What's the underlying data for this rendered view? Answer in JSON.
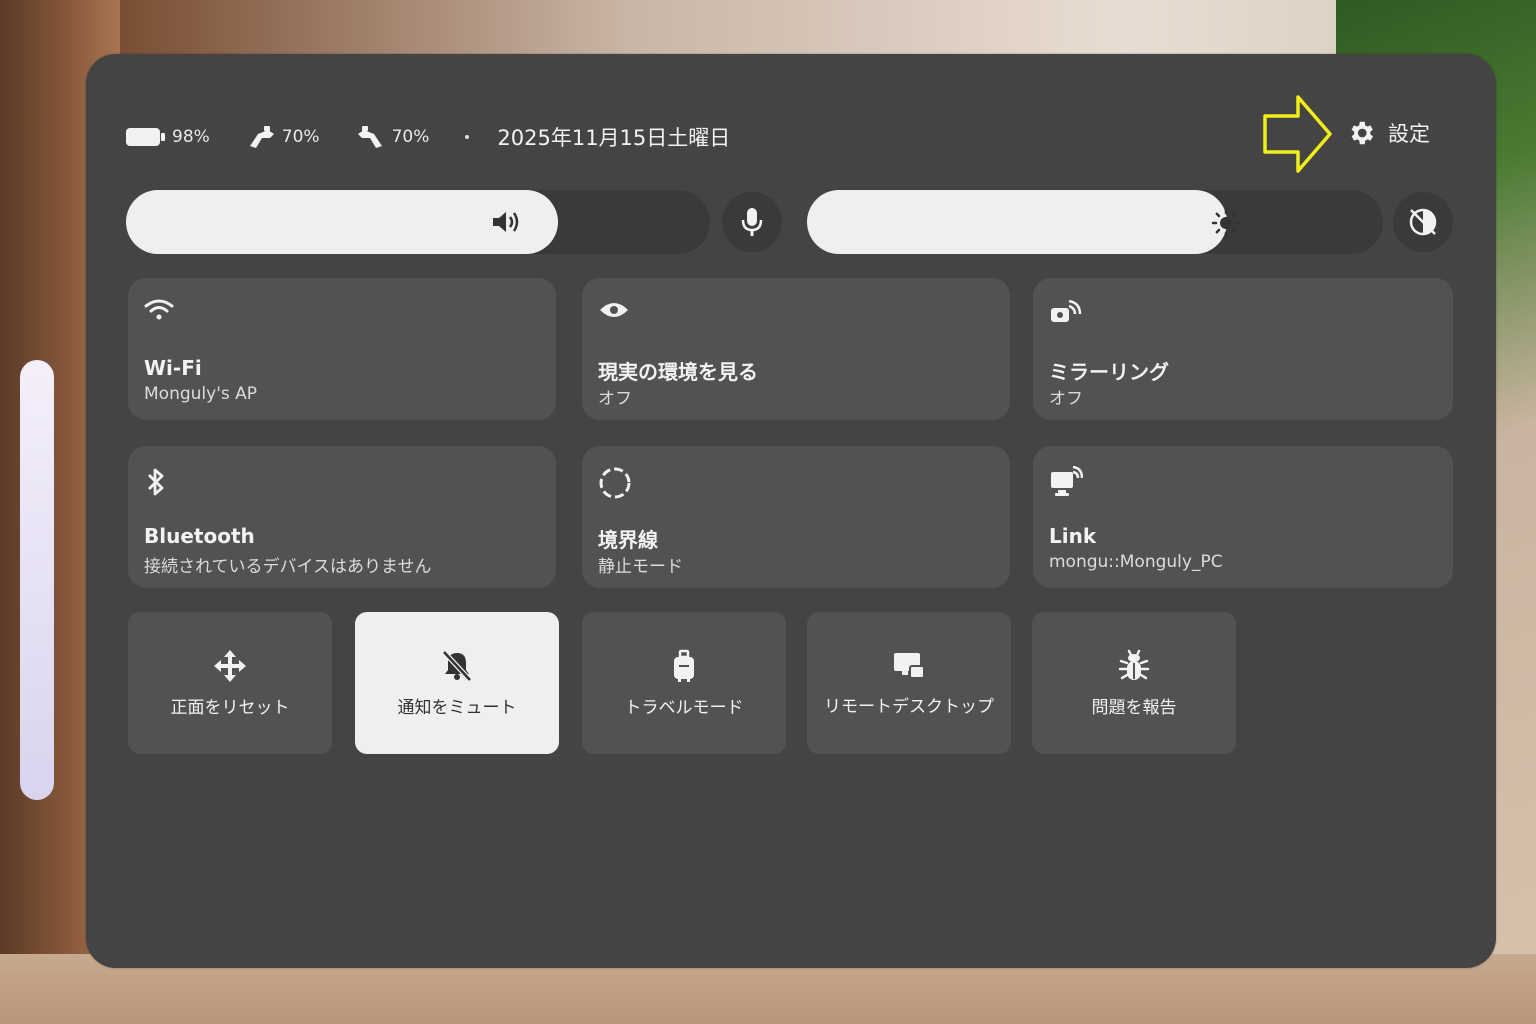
{
  "status": {
    "battery": "98%",
    "controller_left": "70%",
    "controller_right": "70%",
    "date": "2025年11月15日土曜日"
  },
  "settings": {
    "label": "設定"
  },
  "volume": {
    "level": 0.74
  },
  "brightness": {
    "level": 0.73
  },
  "tiles": [
    {
      "title": "Wi-Fi",
      "subtitle": "Monguly's AP",
      "icon": "wifi-icon"
    },
    {
      "title": "現実の環境を見る",
      "subtitle": "オフ",
      "icon": "eye-icon"
    },
    {
      "title": "ミラーリング",
      "subtitle": "オフ",
      "icon": "cast-icon"
    },
    {
      "title": "Bluetooth",
      "subtitle": "接続されているデバイスはありません",
      "icon": "bluetooth-icon"
    },
    {
      "title": "境界線",
      "subtitle": "静止モード",
      "icon": "boundary-icon"
    },
    {
      "title": "Link",
      "subtitle": "mongu::Monguly_PC",
      "icon": "link-icon"
    }
  ],
  "actions": [
    {
      "label": "正面をリセット",
      "icon": "move-icon"
    },
    {
      "label": "通知をミュート",
      "icon": "bell-off-icon",
      "active": true
    },
    {
      "label": "トラベルモード",
      "icon": "luggage-icon"
    },
    {
      "label": "リモートデスクトップ",
      "icon": "remote-desktop-icon"
    },
    {
      "label": "問題を報告",
      "icon": "bug-icon"
    }
  ],
  "colors": {
    "panel": "#444444",
    "tile": "#525252",
    "active": "#efefef",
    "annotation": "#f2ee1a"
  }
}
